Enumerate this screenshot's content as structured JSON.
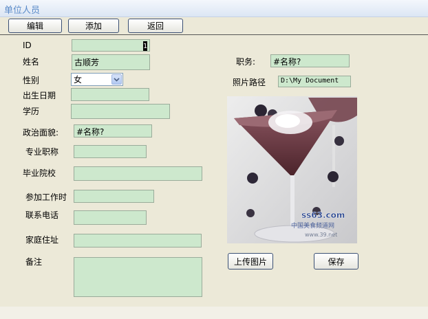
{
  "window": {
    "title": "单位人员"
  },
  "toolbar": {
    "edit": "编辑",
    "add": "添加",
    "back": "返回"
  },
  "form": {
    "id": {
      "label": "ID",
      "value": "1"
    },
    "name": {
      "label": "姓名",
      "value": "古顺芳"
    },
    "gender": {
      "label": "性别",
      "value": "女"
    },
    "birth_date": {
      "label": "出生日期",
      "value": ""
    },
    "education": {
      "label": "学历",
      "value": ""
    },
    "political_status": {
      "label": "政治面貌:",
      "value": "#名称?"
    },
    "professional_title": {
      "label": "专业职称",
      "value": ""
    },
    "graduated_school": {
      "label": "毕业院校",
      "value": ""
    },
    "work_start_time": {
      "label": "参加工作时",
      "value": ""
    },
    "phone": {
      "label": "联系电话",
      "value": ""
    },
    "address": {
      "label": "家庭住址",
      "value": ""
    },
    "notes": {
      "label": "备注",
      "value": ""
    },
    "position": {
      "label": "职务:",
      "value": "#名称?"
    },
    "photo_path": {
      "label": "照片路径",
      "value": "D:\\My Document"
    }
  },
  "photo": {
    "watermark_top": "ss63.com",
    "watermark_mid": "中国美食频道网",
    "watermark_bottom": "www.39.net"
  },
  "actions": {
    "upload": "上传图片",
    "save": "保存"
  },
  "colors": {
    "field_bg": "#CDE8CD",
    "window_bg": "#ECE9D8",
    "title_text": "#5A8AC8"
  }
}
